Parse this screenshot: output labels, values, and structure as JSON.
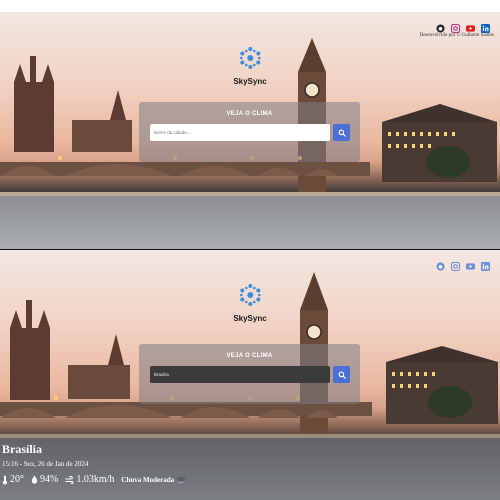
{
  "app": {
    "name": "SkySync"
  },
  "social": {
    "icons": [
      "github-icon",
      "instagram-icon",
      "youtube-icon",
      "linkedin-icon"
    ]
  },
  "credit": "Desenvolvido por © Gulherm Santos",
  "search": {
    "title": "VEJA O CLIMA",
    "placeholder": "Nome da cidade...",
    "value": "Brasilia"
  },
  "weather": {
    "city": "Brasília",
    "datetime": "15:16 - Sex, 26 de Jan de 2024",
    "temperature": "20°",
    "humidity": "94%",
    "wind": "1.03km/h",
    "condition": "Chuva Moderada"
  },
  "colors": {
    "accent": "#4b6fd6",
    "github": "#24292e",
    "instagram": "#c13584",
    "youtube": "#e02020",
    "linkedin": "#0a66c2"
  }
}
